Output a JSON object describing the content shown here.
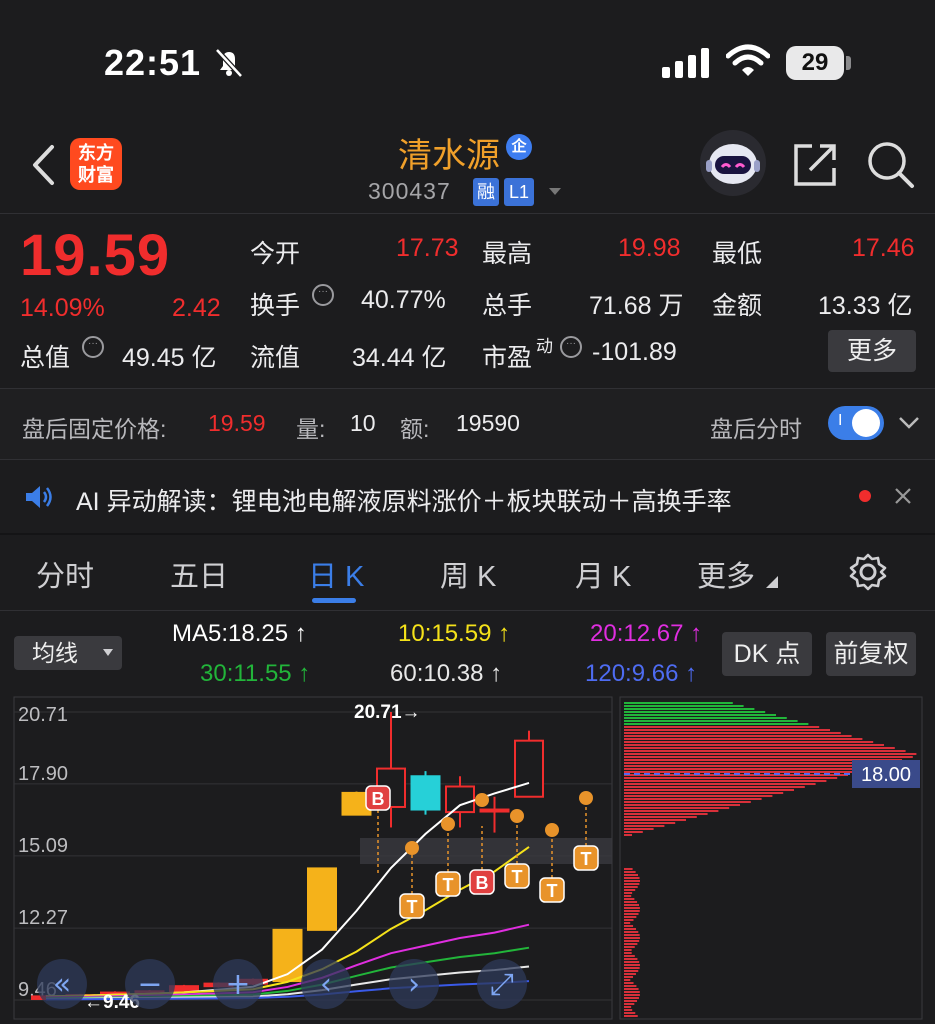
{
  "status_bar": {
    "time": "22:51",
    "battery": "29"
  },
  "header": {
    "logo_line1": "东方",
    "logo_line2": "财富",
    "stock_name": "清水源",
    "qi_badge": "企",
    "stock_code": "300437",
    "tag_rong": "融",
    "tag_level": "L1"
  },
  "quote": {
    "price": "19.59",
    "change_pct": "14.09%",
    "change_amt": "2.42",
    "open_label": "今开",
    "open_value": "17.73",
    "high_label": "最高",
    "high_value": "19.98",
    "low_label": "最低",
    "low_value": "17.46",
    "turnover_label": "换手",
    "turnover_value": "40.77%",
    "volume_label": "总手",
    "volume_value": "71.68 万",
    "amount_label": "金额",
    "amount_value": "13.33 亿",
    "mktcap_label": "总值",
    "mktcap_value": "49.45 亿",
    "float_label": "流值",
    "float_value": "34.44 亿",
    "pe_label": "市盈",
    "pe_sup": "动",
    "pe_value": "-101.89",
    "more_label": "更多"
  },
  "after_hours": {
    "price_label": "盘后固定价格:",
    "price_value": "19.59",
    "vol_label": "量:",
    "vol_value": "10",
    "amt_label": "额:",
    "amt_value": "19590",
    "timeline_label": "盘后分时",
    "toggle_text": "I"
  },
  "ai_banner": {
    "text": "AI 异动解读：锂电池电解液原料涨价＋板块联动＋高换手率"
  },
  "tabs": [
    "分时",
    "五日",
    "日 K",
    "周 K",
    "月 K",
    "更多"
  ],
  "active_tab": "日 K",
  "indicator": {
    "ma_button": "均线",
    "ma5": "MA5:18.25 ↑",
    "ma10": "10:15.59 ↑",
    "ma20": "20:12.67 ↑",
    "ma30": "30:11.55 ↑",
    "ma60": "60:10.38 ↑",
    "ma120": "120:9.66 ↑",
    "dk_button": "DK 点",
    "fq_button": "前复权",
    "colors": {
      "ma5": "#ffffff",
      "ma10": "#f5e21a",
      "ma20": "#e02ee0",
      "ma30": "#22b53a",
      "ma60": "#e8e8e8",
      "ma120": "#3a5ae8",
      "up": "#f02d2d",
      "down": "#26d0d8"
    }
  },
  "chart_data": {
    "type": "candlestick",
    "y_tick_labels": [
      "20.71",
      "17.90",
      "15.09",
      "12.27",
      "9.46"
    ],
    "ylim": [
      9.46,
      20.71
    ],
    "max_annotation": "20.71→",
    "min_annotation": "←9.46",
    "chip_price_label": "18.00",
    "candles": [
      {
        "open": 9.5,
        "close": 9.6,
        "high": 9.65,
        "low": 9.46
      },
      {
        "open": 9.6,
        "close": 9.65,
        "high": 9.7,
        "low": 9.55
      },
      {
        "open": 9.65,
        "close": 9.75,
        "high": 9.8,
        "low": 9.6
      },
      {
        "open": 9.75,
        "close": 9.8,
        "high": 9.85,
        "low": 9.7
      },
      {
        "open": 9.8,
        "close": 10.0,
        "high": 10.05,
        "low": 9.75
      },
      {
        "open": 10.0,
        "close": 10.1,
        "high": 10.15,
        "low": 9.95
      },
      {
        "open": 10.1,
        "close": 10.25,
        "high": 10.3,
        "low": 10.05
      },
      {
        "open": 10.2,
        "close": 12.2,
        "high": 12.2,
        "low": 10.2
      },
      {
        "open": 12.2,
        "close": 14.6,
        "high": 14.6,
        "low": 12.2
      },
      {
        "open": 16.7,
        "close": 17.55,
        "high": 17.6,
        "low": 16.7
      },
      {
        "open": 17.0,
        "close": 18.5,
        "high": 20.71,
        "low": 16.2
      },
      {
        "open": 18.2,
        "close": 16.9,
        "high": 18.4,
        "low": 16.7
      },
      {
        "open": 16.8,
        "close": 17.8,
        "high": 18.2,
        "low": 16.2
      },
      {
        "open": 16.9,
        "close": 16.9,
        "high": 17.4,
        "low": 16.0
      },
      {
        "open": 17.4,
        "close": 19.59,
        "high": 19.98,
        "low": 17.46
      }
    ],
    "markers": [
      "B",
      "T",
      "T",
      "B",
      "T",
      "T",
      "T"
    ]
  },
  "chart_controls": [
    "zoom-left",
    "zoom-out",
    "zoom-in",
    "move-left",
    "move-right",
    "fullscreen"
  ]
}
